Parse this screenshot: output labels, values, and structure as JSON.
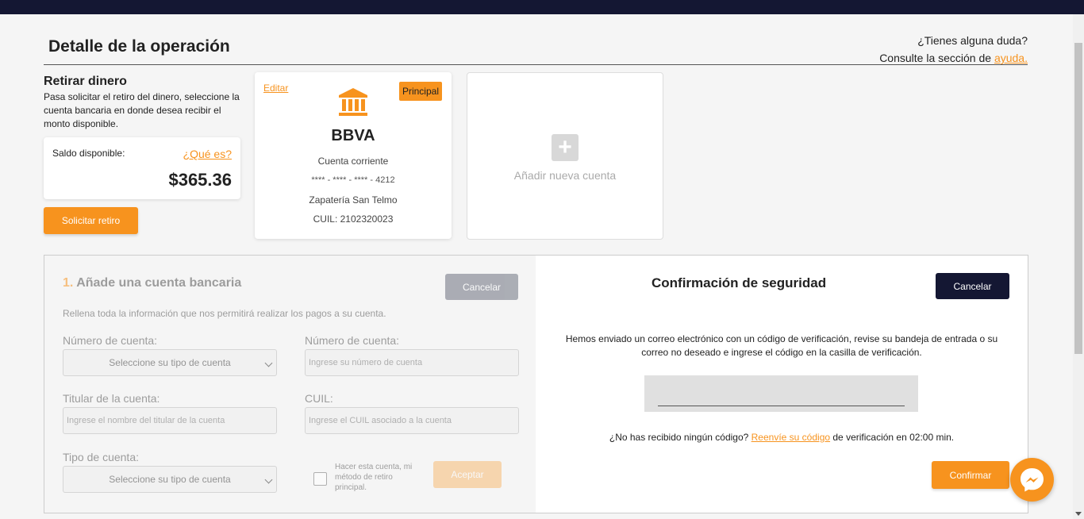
{
  "page": {
    "title": "Detalle de la operación",
    "help_line1": "¿Tienes alguna duda?",
    "help_line2": "Consulte la sección de ",
    "help_link": "ayuda."
  },
  "withdraw": {
    "title": "Retirar dinero",
    "description": "Pasa solicitar el retiro del dinero, seleccione la cuenta bancaria en donde desea recibir el monto disponible.",
    "balance_label": "Saldo disponible:",
    "balance_help": "¿Qué es?",
    "balance_amount": "$365.36",
    "request_button": "Solicitar retiro"
  },
  "bank_card": {
    "edit_label": "Editar",
    "badge": "Principal",
    "icon": "bank-icon",
    "bank_name": "BBVA",
    "account_type": "Cuenta corriente",
    "account_number": "**** - **** - **** - 4212",
    "holder": "Zapatería San Telmo",
    "cuil": "CUIL: 2102320023"
  },
  "add_card": {
    "icon": "plus-icon",
    "label": "Añadir nueva cuenta"
  },
  "add_form": {
    "step": "1.",
    "title": "Añade una cuenta bancaria",
    "cancel_button": "Cancelar",
    "description": "Rellena toda la información que nos permitirá realizar los pagos a su cuenta.",
    "account_number_label_1": "Número de cuenta:",
    "account_number_select": "Seleccione su tipo de cuenta",
    "account_number_label_2": "Número de cuenta:",
    "account_number_placeholder": "Ingrese su número de cuenta",
    "holder_label": "Titular de la cuenta:",
    "holder_placeholder": "Ingrese el nombre del titular de la cuenta",
    "cuil_label": "CUIL:",
    "cuil_placeholder": "Ingrese el CUIL asociado a la cuenta",
    "account_type_label": "Tipo de cuenta:",
    "account_type_select": "Seleccione su tipo de cuenta",
    "checkbox_label": "Hacer esta cuenta, mi método de retiro principal.",
    "accept_button": "Aceptar"
  },
  "security": {
    "title": "Confirmación de seguridad",
    "cancel_button": "Cancelar",
    "message": "Hemos enviado un correo electrónico con un código de verificación, revise su bandeja de entrada o su correo no deseado e ingrese el código en la casilla de verificación.",
    "code_value": "",
    "resend_prefix": "¿No has recibido ningún código? ",
    "resend_link": "Reenvíe su código",
    "resend_suffix": " de verificación en 02:00 min.",
    "confirm_button": "Confirmar"
  },
  "colors": {
    "accent": "#f7931e",
    "navy": "#141733"
  },
  "chat": {
    "icon": "messenger-icon"
  }
}
